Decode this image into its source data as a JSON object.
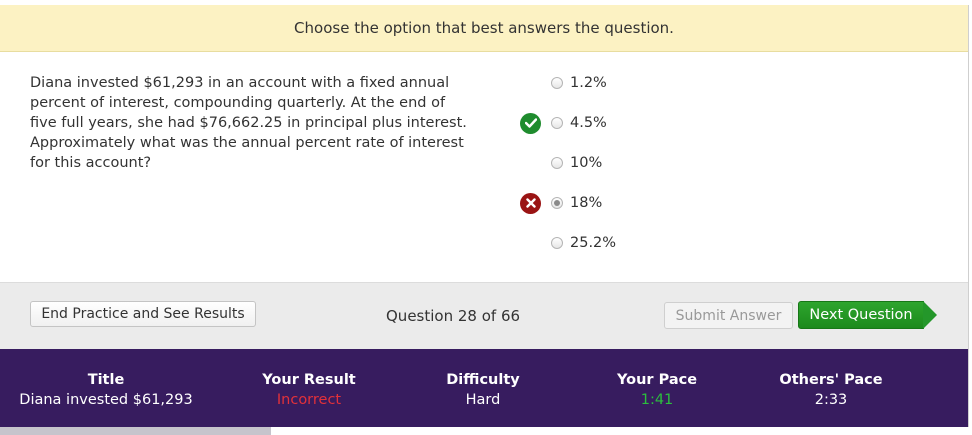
{
  "instruction": "Choose the option that best answers the question.",
  "question": "Diana invested $61,293 in an account with a fixed annual percent of interest, compounding quarterly. At the end of five full years, she had $76,662.25 in principal plus interest. Approximately what was the annual percent rate of interest for this account?",
  "choices": [
    {
      "label": "1.2%",
      "selected": false,
      "status": "none"
    },
    {
      "label": "4.5%",
      "selected": false,
      "status": "correct"
    },
    {
      "label": "10%",
      "selected": false,
      "status": "none"
    },
    {
      "label": "18%",
      "selected": true,
      "status": "incorrect"
    },
    {
      "label": "25.2%",
      "selected": false,
      "status": "none"
    }
  ],
  "toolbar": {
    "end_label": "End Practice and See Results",
    "counter": "Question 28 of 66",
    "submit_label": "Submit Answer",
    "next_label": "Next Question"
  },
  "stats": {
    "title_head": "Title",
    "title_val": "Diana invested $61,293",
    "result_head": "Your Result",
    "result_val": "Incorrect",
    "difficulty_head": "Difficulty",
    "difficulty_val": "Hard",
    "pace_head": "Your Pace",
    "pace_val": "1:41",
    "others_head": "Others' Pace",
    "others_val": "2:33"
  },
  "progress": {
    "fraction": 0.2788
  },
  "colors": {
    "banner": "#fcf2c3",
    "stats_bg": "#371c5f",
    "correct": "#1f8c2e",
    "incorrect": "#9a1414",
    "next_button": "#24972a"
  },
  "icons": {
    "correct": "check-icon",
    "incorrect": "x-icon"
  }
}
